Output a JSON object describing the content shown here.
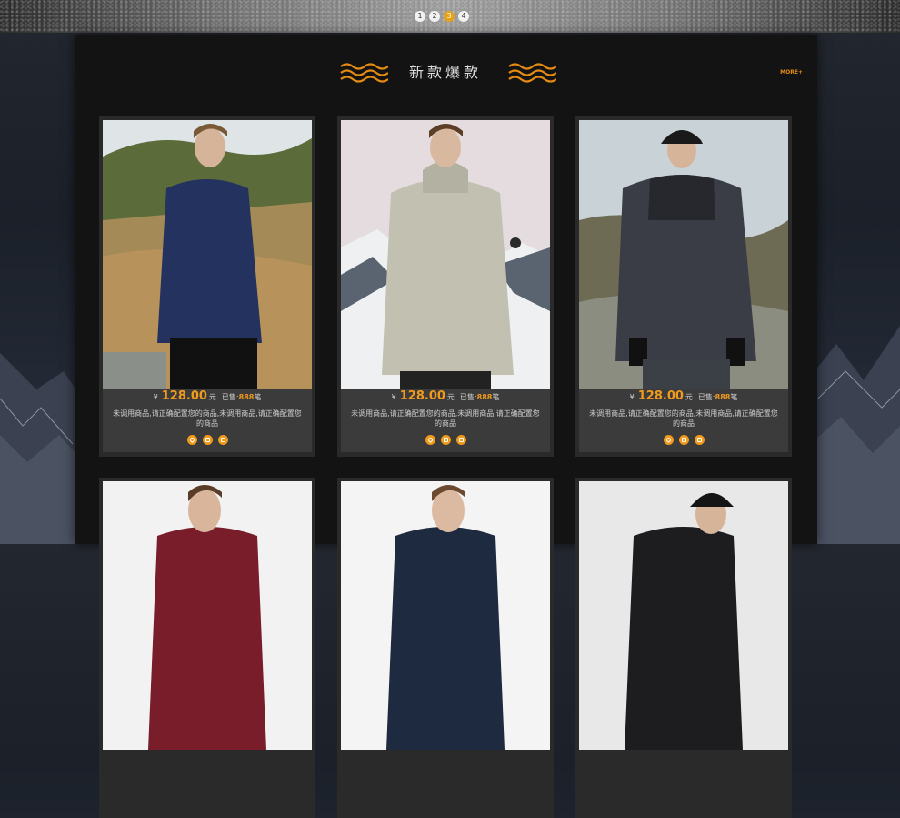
{
  "slider": {
    "dots": [
      "1",
      "2",
      "3",
      "4"
    ],
    "active": 3
  },
  "section": {
    "title": "新款爆款",
    "more_label": "MORE+"
  },
  "products": [
    {
      "currency": "¥",
      "price": "128.00",
      "unit": "元",
      "sold_label": "已售:",
      "sold": "888",
      "sold_unit": "笔",
      "desc": "未调用商品,请正确配置您的商品,未调用商品,请正确配置您的商品",
      "jacket_color": "#23325e"
    },
    {
      "currency": "¥",
      "price": "128.00",
      "unit": "元",
      "sold_label": "已售:",
      "sold": "888",
      "sold_unit": "笔",
      "desc": "未调用商品,请正确配置您的商品,未调用商品,请正确配置您的商品",
      "jacket_color": "#c2c0b1"
    },
    {
      "currency": "¥",
      "price": "128.00",
      "unit": "元",
      "sold_label": "已售:",
      "sold": "888",
      "sold_unit": "笔",
      "desc": "未调用商品,请正确配置您的商品,未调用商品,请正确配置您的商品",
      "jacket_color": "#3a3d45"
    }
  ],
  "second_row": [
    {
      "jacket_color": "#7a1d2a"
    },
    {
      "jacket_color": "#1e2a3f"
    },
    {
      "jacket_color": "#1d1d1f"
    }
  ],
  "colors": {
    "accent": "#f29a1c",
    "panel": "#131313",
    "card": "#2a2a2a"
  }
}
